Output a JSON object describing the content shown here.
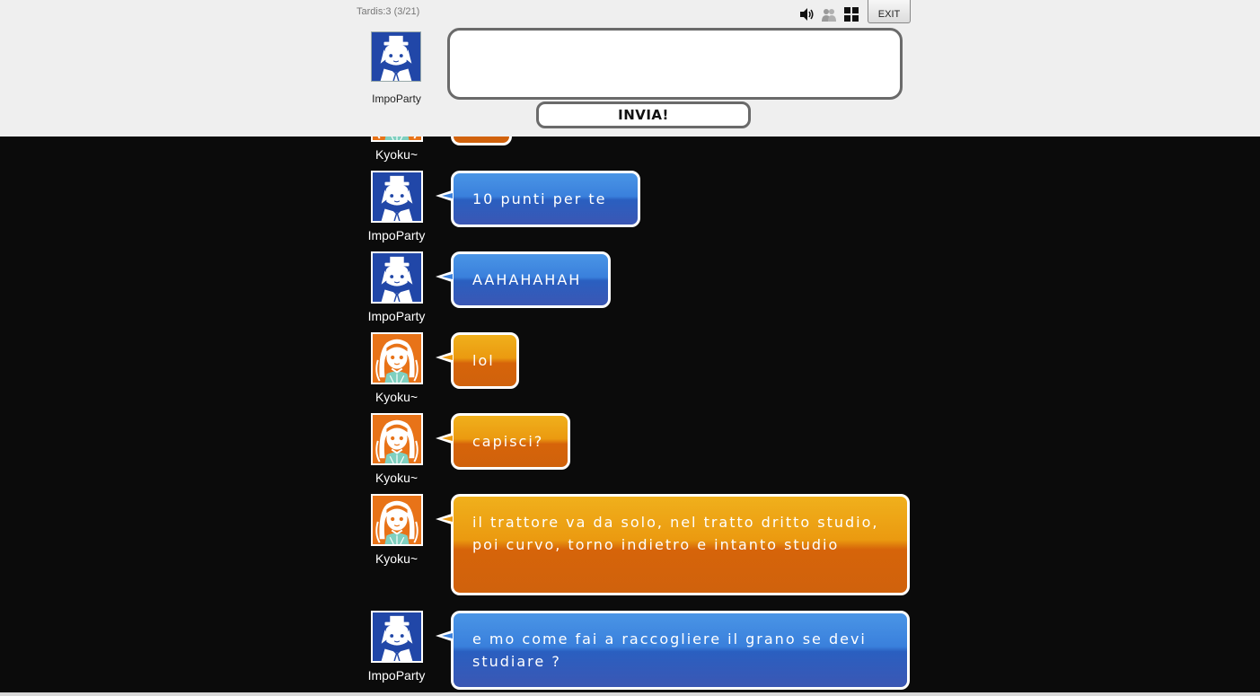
{
  "header": {
    "room_status": "Tardis:3 (3/21)",
    "exit_label": "EXIT",
    "send_label": "INVIA!",
    "input_value": "",
    "self_name": "ImpoParty",
    "icons": [
      "speaker-icon",
      "users-icon",
      "grid-layout-icon"
    ]
  },
  "colors": {
    "header_bg": "#efefef",
    "chat_bg": "#0b0b0b",
    "blue_bubble": "#3a80dc",
    "orange_bubble": "#eb9a10",
    "avatar_blue": "#2147a8",
    "avatar_orange": "#e87318"
  },
  "messages": [
    {
      "user": "Kyoku~",
      "text": "",
      "color": "orange"
    },
    {
      "user": "ImpoParty",
      "text": "10 punti per te",
      "color": "blue"
    },
    {
      "user": "ImpoParty",
      "text": "AAHAHAHAH",
      "color": "blue"
    },
    {
      "user": "Kyoku~",
      "text": "lol",
      "color": "orange"
    },
    {
      "user": "Kyoku~",
      "text": "capisci?",
      "color": "orange"
    },
    {
      "user": "Kyoku~",
      "text": "il trattore va da solo, nel tratto dritto studio, poi curvo, torno indietro e intanto studio",
      "color": "orange"
    },
    {
      "user": "ImpoParty",
      "text": "e mo come fai a raccogliere il grano se devi studiare ?",
      "color": "blue"
    }
  ]
}
